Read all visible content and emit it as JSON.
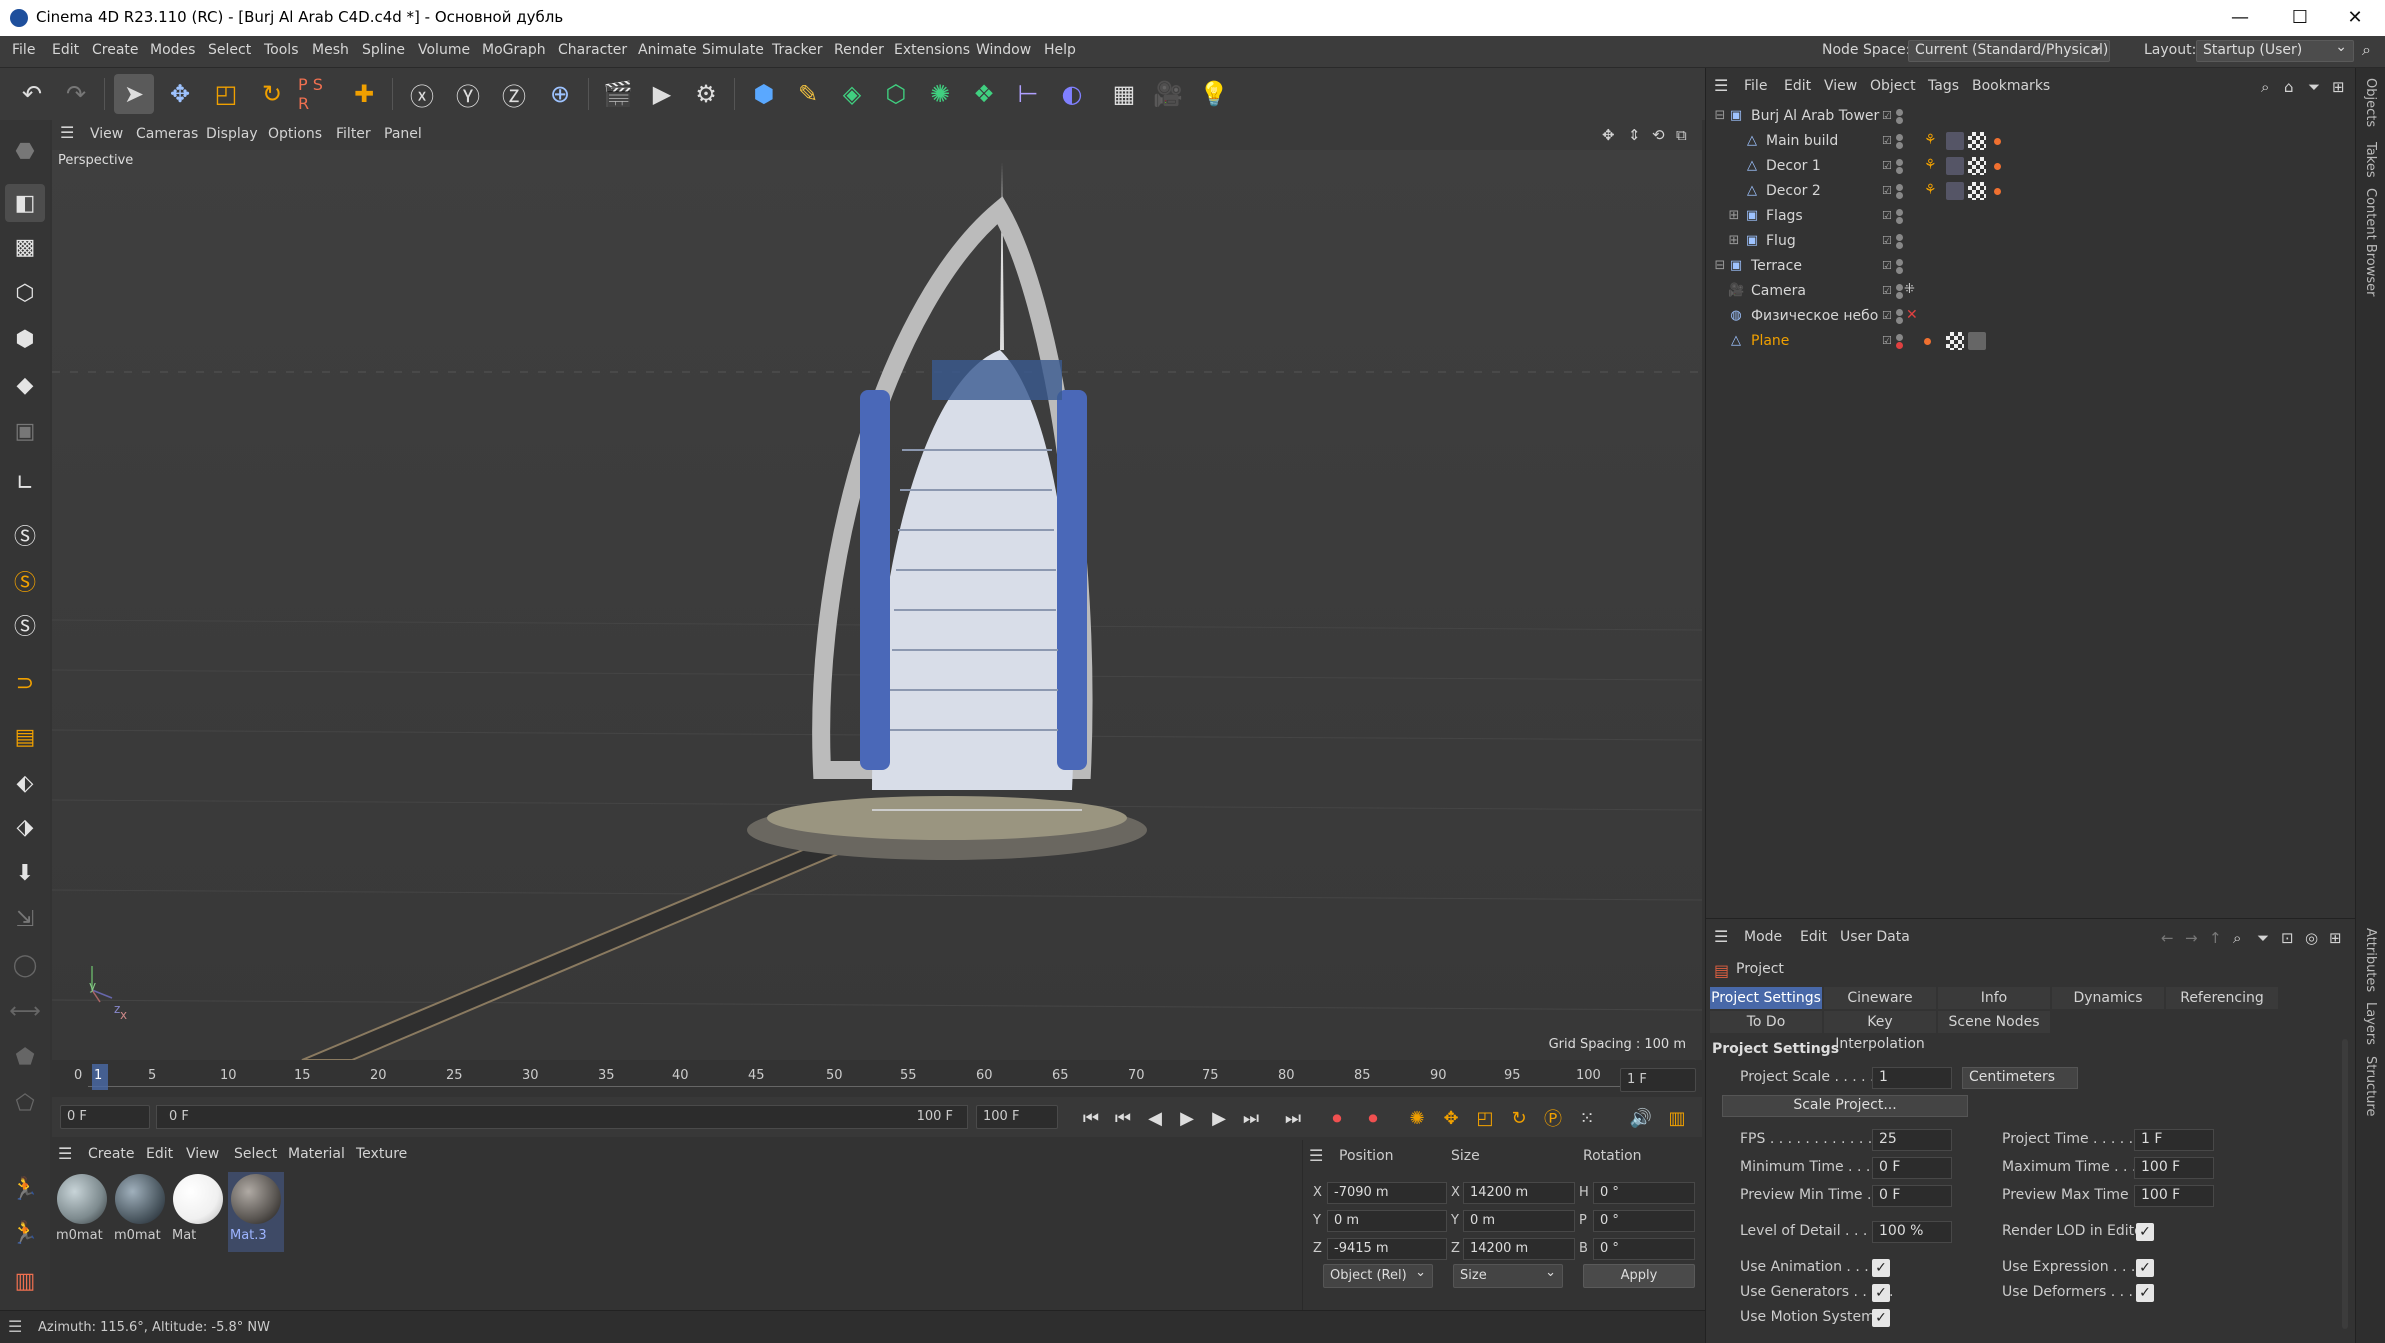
{
  "window": {
    "title": "Cinema 4D R23.110 (RC) - [Burj Al Arab C4D.c4d *] - Основной дубль",
    "minimize": "—",
    "maximize": "☐",
    "close": "✕"
  },
  "menubar": {
    "items": [
      "File",
      "Edit",
      "Create",
      "Modes",
      "Select",
      "Tools",
      "Mesh",
      "Spline",
      "Volume",
      "MoGraph",
      "Character",
      "Animate",
      "Simulate",
      "Tracker",
      "Render",
      "Extensions",
      "Window",
      "Help"
    ],
    "node_space_label": "Node Space:",
    "node_space_value": "Current (Standard/Physical)",
    "layout_label": "Layout:",
    "layout_value": "Startup (User)"
  },
  "toolbar": {
    "icons": [
      "undo-icon",
      "redo-icon",
      "select-icon",
      "move-icon",
      "scale-icon",
      "rotate-icon",
      "psr-icon",
      "add-icon",
      "x-axis-icon",
      "y-axis-icon",
      "z-axis-icon",
      "world-icon",
      "render-region-icon",
      "render-view-icon",
      "render-settings-icon",
      "cube-icon",
      "pen-icon",
      "subdivision-icon",
      "extrude-icon",
      "cloner-icon",
      "generator-icon",
      "deformer-icon",
      "field-icon",
      "floor-icon",
      "camera-icon",
      "light-icon"
    ]
  },
  "viewport": {
    "menu": [
      "View",
      "Cameras",
      "Display",
      "Options",
      "Filter",
      "Panel"
    ],
    "name": "Perspective",
    "grid_spacing": "Grid Spacing : 100 m",
    "axis_y": "y",
    "axis_z": "z",
    "axis_x": "x"
  },
  "timeline": {
    "ticks": [
      "0",
      "5",
      "10",
      "15",
      "20",
      "25",
      "30",
      "35",
      "40",
      "45",
      "50",
      "55",
      "60",
      "65",
      "70",
      "75",
      "80",
      "85",
      "90",
      "95",
      "100"
    ],
    "current_marker": "1",
    "frame_field": "1 F"
  },
  "playback": {
    "start": "0 F",
    "current": "0 F",
    "end": "100 F",
    "end_field": "100 F"
  },
  "materials": {
    "menu": [
      "Create",
      "Edit",
      "View",
      "Select",
      "Material",
      "Texture"
    ],
    "items": [
      {
        "name": "m0mat",
        "color": "#7d8a8e"
      },
      {
        "name": "m0mat",
        "color": "#4d5a63"
      },
      {
        "name": "Mat",
        "color": "#f0f0f0"
      },
      {
        "name": "Mat.3",
        "color": "#5a5652"
      }
    ]
  },
  "coordinates": {
    "headers": [
      "Position",
      "Size",
      "Rotation"
    ],
    "rows": [
      {
        "axis": "X",
        "pos": "-7090 m",
        "saxis": "X",
        "size": "14200 m",
        "raxis": "H",
        "rot": "0 °"
      },
      {
        "axis": "Y",
        "pos": "0 m",
        "saxis": "Y",
        "size": "0 m",
        "raxis": "P",
        "rot": "0 °"
      },
      {
        "axis": "Z",
        "pos": "-9415 m",
        "saxis": "Z",
        "size": "14200 m",
        "raxis": "B",
        "rot": "0 °"
      }
    ],
    "mode": "Object (Rel)",
    "size_mode": "Size",
    "apply": "Apply"
  },
  "status": {
    "text": "Azimuth: 115.6°, Altitude: -5.8°  NW"
  },
  "object_manager": {
    "menu": [
      "File",
      "Edit",
      "View",
      "Object",
      "Tags",
      "Bookmarks"
    ],
    "objects": [
      {
        "name": "Burj Al Arab Tower",
        "indent": 0,
        "icon": "null-icon"
      },
      {
        "name": "Main build",
        "indent": 1,
        "icon": "polygon-icon"
      },
      {
        "name": "Decor 1",
        "indent": 1,
        "icon": "polygon-icon"
      },
      {
        "name": "Decor 2",
        "indent": 1,
        "icon": "polygon-icon"
      },
      {
        "name": "Flags",
        "indent": 1,
        "icon": "null-icon"
      },
      {
        "name": "Flug",
        "indent": 1,
        "icon": "null-icon"
      },
      {
        "name": "Terrace",
        "indent": 0,
        "icon": "null-icon"
      },
      {
        "name": "Camera",
        "indent": 0,
        "icon": "camera-icon"
      },
      {
        "name": "Физическое небо",
        "indent": 0,
        "icon": "sky-icon"
      },
      {
        "name": "Plane",
        "indent": 0,
        "icon": "polygon-icon",
        "selected": true
      }
    ]
  },
  "attributes": {
    "menu": [
      "Mode",
      "Edit",
      "User Data"
    ],
    "object": "Project",
    "tabs_row1": [
      "Project Settings",
      "Cineware",
      "Info",
      "Dynamics",
      "Referencing"
    ],
    "tabs_row2": [
      "To Do",
      "Key Interpolation",
      "Scene Nodes"
    ],
    "section": "Project Settings",
    "project_scale_label": "Project Scale . . . . .",
    "project_scale": "1",
    "scale_unit": "Centimeters",
    "scale_button": "Scale Project...",
    "fps_label": "FPS . . . . . . . . . . . . . .",
    "fps": "25",
    "project_time_label": "Project Time . . . . . . .",
    "project_time": "1 F",
    "min_time_label": "Minimum Time . . . . .",
    "min_time": "0 F",
    "max_time_label": "Maximum Time . . . . .",
    "max_time": "100 F",
    "pmin_label": "Preview Min Time . . .",
    "pmin": "0 F",
    "pmax_label": "Preview Max Time . . .",
    "pmax": "100 F",
    "lod_label": "Level of Detail . . . . .",
    "lod": "100 %",
    "render_lod_label": "Render LOD in Editor",
    "use_anim_label": "Use Animation . . . . .",
    "use_expr_label": "Use Expression . . . . .",
    "use_gen_label": "Use Generators . . . . .",
    "use_def_label": "Use Deformers . . . . .",
    "use_motion_label": "Use Motion System"
  },
  "side_tabs": [
    "Objects",
    "Takes",
    "Content Browser",
    "Attributes",
    "Layers",
    "Structure"
  ]
}
